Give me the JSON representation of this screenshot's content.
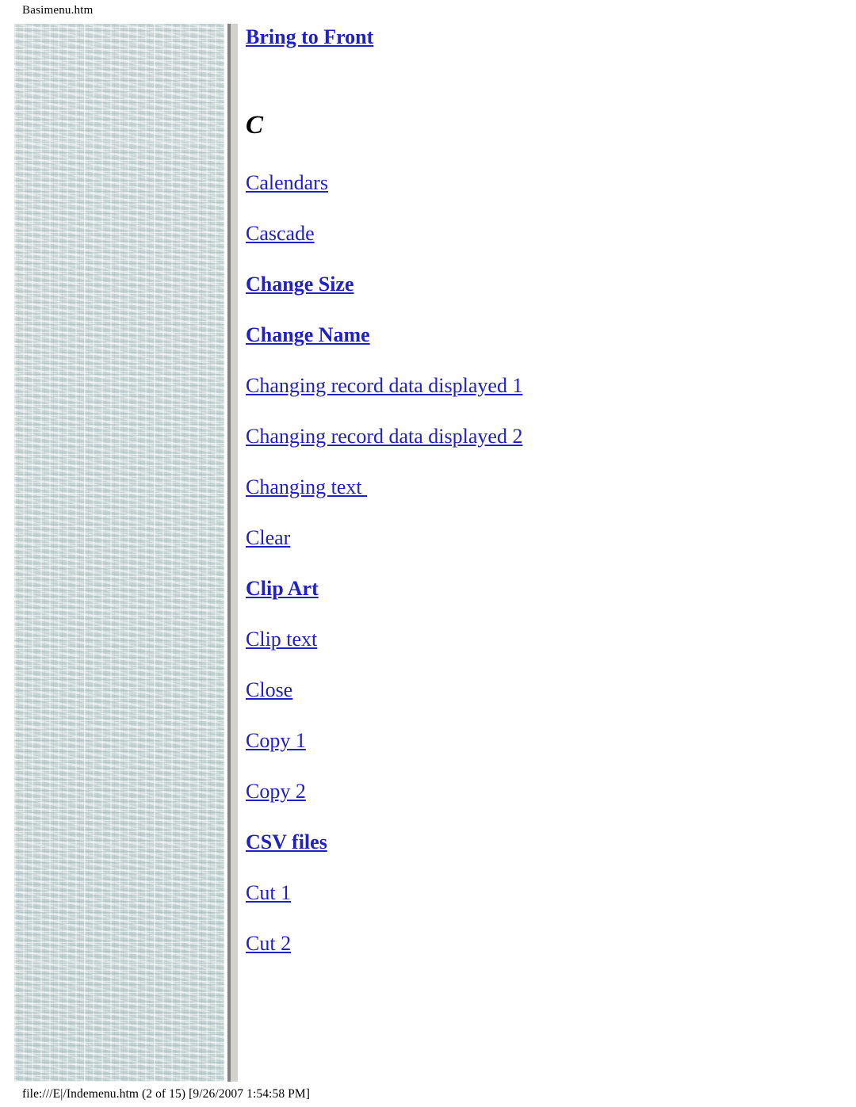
{
  "page": {
    "header_title": "Basimenu.htm",
    "footer_text": "file:///E|/Indemenu.htm (2 of 15) [9/26/2007 1:54:58 PM]",
    "link_color": "#2020c8",
    "text_color": "#000000",
    "background_color": "#ffffff",
    "sidebar_color": "#cfdcdc",
    "divider_dark_color": "#808080",
    "divider_light_color": "#d4d0cb"
  },
  "index": {
    "top_link": {
      "label": "Bring to Front",
      "bold": true
    },
    "letter_heading": "C",
    "links": [
      {
        "label": "Calendars",
        "bold": false
      },
      {
        "label": "Cascade",
        "bold": false
      },
      {
        "label": "Change Size",
        "bold": true
      },
      {
        "label": "Change Name",
        "bold": true
      },
      {
        "label": "Changing record data displayed 1",
        "bold": false
      },
      {
        "label": "Changing record data displayed 2",
        "bold": false
      },
      {
        "label": "Changing text ",
        "bold": false
      },
      {
        "label": "Clear",
        "bold": false
      },
      {
        "label": "Clip Art",
        "bold": true
      },
      {
        "label": "Clip text",
        "bold": false
      },
      {
        "label": "Close",
        "bold": false
      },
      {
        "label": "Copy 1",
        "bold": false
      },
      {
        "label": "Copy 2",
        "bold": false
      },
      {
        "label": "CSV files",
        "bold": true
      },
      {
        "label": "Cut 1",
        "bold": false
      },
      {
        "label": "Cut 2",
        "bold": false
      }
    ]
  }
}
